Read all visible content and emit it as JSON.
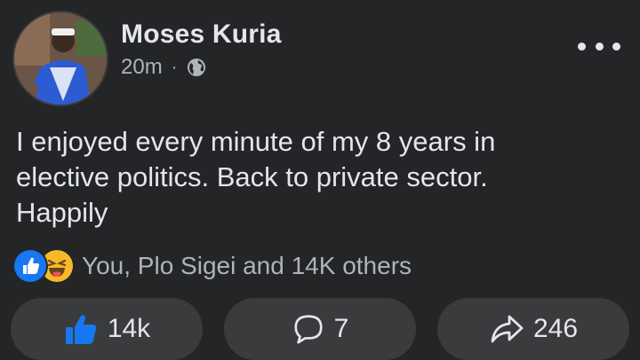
{
  "author": {
    "name": "Moses Kuria",
    "time": "20m",
    "separator": "·"
  },
  "post": {
    "lines": [
      "I enjoyed every minute of my 8 years in",
      "elective politics. Back to private sector.",
      "Happily"
    ]
  },
  "reactions": {
    "text": "You, Plo Sigei and 14K others",
    "icons": [
      "like-icon",
      "haha-icon"
    ]
  },
  "actions": {
    "likes": "14k",
    "comments": "7",
    "shares": "246"
  },
  "colors": {
    "background": "#242526",
    "pill": "#3a3b3c",
    "like_blue": "#1877f2",
    "text": "#e4e6eb",
    "secondary": "#b0b3b8"
  }
}
